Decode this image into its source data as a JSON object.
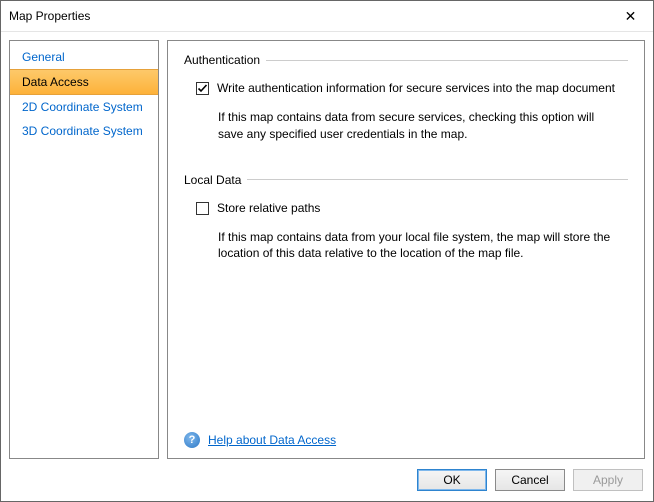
{
  "window": {
    "title": "Map Properties",
    "close_glyph": "✕"
  },
  "nav": {
    "items": [
      {
        "label": "General"
      },
      {
        "label": "Data Access"
      },
      {
        "label": "2D Coordinate System"
      },
      {
        "label": "3D Coordinate System"
      }
    ],
    "selected_index": 1
  },
  "authentication": {
    "group_title": "Authentication",
    "checkbox_label": "Write authentication information for secure services into the map document",
    "checked": true,
    "description": "If this map contains data from secure services, checking this option will save any specified user credentials in the map."
  },
  "local_data": {
    "group_title": "Local Data",
    "checkbox_label": "Store relative paths",
    "checked": false,
    "description": "If this map contains data from your local file system, the map will store the location of this data relative to the location of the map file."
  },
  "help": {
    "icon_glyph": "?",
    "link_text": "Help about Data Access"
  },
  "buttons": {
    "ok": "OK",
    "cancel": "Cancel",
    "apply": "Apply"
  }
}
